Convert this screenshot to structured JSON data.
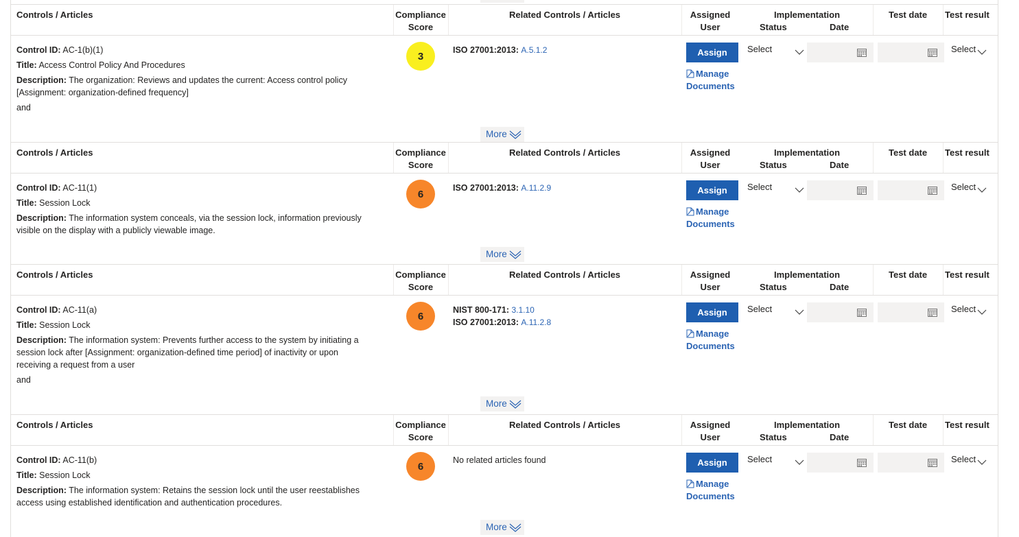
{
  "headers": {
    "controls": "Controls / Articles",
    "compliance_1": "Compliance",
    "compliance_2": "Score",
    "related": "Related Controls / Articles",
    "assigned_1": "Assigned",
    "assigned_2": "User",
    "implementation": "Implementation",
    "status": "Status",
    "date": "Date",
    "test_date": "Test date",
    "test_result": "Test result"
  },
  "labels": {
    "control_id": "Control ID:",
    "title": "Title:",
    "description": "Description:",
    "assign": "Assign",
    "manage_1": "Manage",
    "manage_2": "Documents",
    "select": "Select",
    "more": "More"
  },
  "colors": {
    "score_yellow": "#f9ef1f",
    "score_orange": "#f7862a",
    "assign_bg": "#1f5fb0",
    "link": "#2b64b4"
  },
  "controls": [
    {
      "id": "AC-1(b)(1)",
      "title": "Access Control Policy And Procedures",
      "description_lines": [
        "The organization: Reviews and updates the current: Access control policy",
        "[Assignment: organization-defined frequency]"
      ],
      "extra": "and",
      "score": "3",
      "score_color": "yellow",
      "related": [
        {
          "standard": "ISO 27001:2013:",
          "article": "A.5.1.2"
        }
      ],
      "related_empty": ""
    },
    {
      "id": "AC-11(1)",
      "title": "Session Lock",
      "description_lines": [
        "The information system conceals, via the session lock, information previously",
        "visible on the display with a publicly viewable image."
      ],
      "extra": "",
      "score": "6",
      "score_color": "orange",
      "related": [
        {
          "standard": "ISO 27001:2013:",
          "article": "A.11.2.9"
        }
      ],
      "related_empty": ""
    },
    {
      "id": "AC-11(a)",
      "title": "Session Lock",
      "description_lines": [
        "The information system: Prevents further access to the system by initiating a",
        "session lock after [Assignment: organization-defined time period] of inactivity or upon",
        "receiving a request from a user"
      ],
      "extra": "and",
      "score": "6",
      "score_color": "orange",
      "related": [
        {
          "standard": "NIST 800-171:",
          "article": "3.1.10"
        },
        {
          "standard": "ISO 27001:2013:",
          "article": "A.11.2.8"
        }
      ],
      "related_empty": ""
    },
    {
      "id": "AC-11(b)",
      "title": "Session Lock",
      "description_lines": [
        "The information system: Retains the session lock until the user reestablishes",
        "access using established identification and authentication procedures."
      ],
      "extra": "",
      "score": "6",
      "score_color": "orange",
      "related": [],
      "related_empty": "No related articles found"
    }
  ]
}
